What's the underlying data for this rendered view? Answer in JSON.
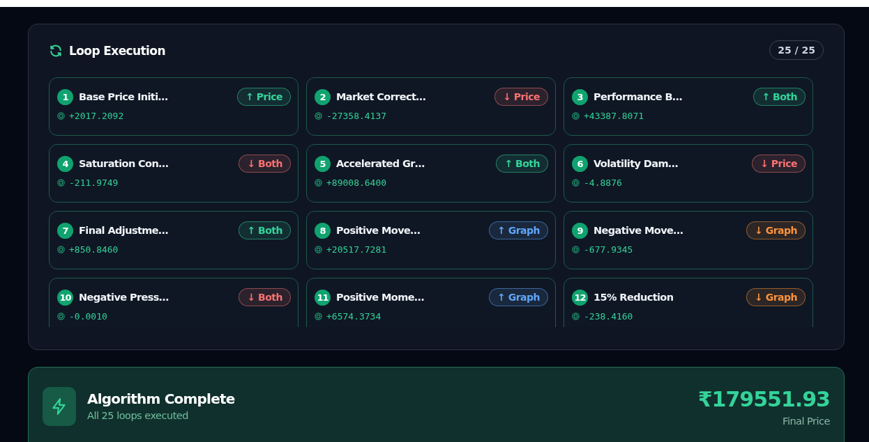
{
  "loop_panel": {
    "title": "Loop Execution",
    "counter": "25 / 25",
    "loops": [
      {
        "number": "1",
        "name": "Base Price Initi…",
        "badge": {
          "text": "↑ Price",
          "color": "#34d399"
        },
        "value": "+2017.2092"
      },
      {
        "number": "2",
        "name": "Market Correct…",
        "badge": {
          "text": "↓ Price",
          "color": "#f87171"
        },
        "value": "-27358.4137"
      },
      {
        "number": "3",
        "name": "Performance B…",
        "badge": {
          "text": "↑ Both",
          "color": "#34d399"
        },
        "value": "+43387.8071"
      },
      {
        "number": "4",
        "name": "Saturation Con…",
        "badge": {
          "text": "↓ Both",
          "color": "#f87171"
        },
        "value": "-211.9749"
      },
      {
        "number": "5",
        "name": "Accelerated Gr…",
        "badge": {
          "text": "↑ Both",
          "color": "#34d399"
        },
        "value": "+89008.6400"
      },
      {
        "number": "6",
        "name": "Volatility Dam…",
        "badge": {
          "text": "↓ Price",
          "color": "#f87171"
        },
        "value": "-4.8876"
      },
      {
        "number": "7",
        "name": "Final Adjustme…",
        "badge": {
          "text": "↑ Both",
          "color": "#34d399"
        },
        "value": "+850.8460"
      },
      {
        "number": "8",
        "name": "Positive Move…",
        "badge": {
          "text": "↑ Graph",
          "color": "#60a5fa"
        },
        "value": "+20517.7281"
      },
      {
        "number": "9",
        "name": "Negative Move…",
        "badge": {
          "text": "↓ Graph",
          "color": "#fb923c"
        },
        "value": "-677.9345"
      },
      {
        "number": "10",
        "name": "Negative Press…",
        "badge": {
          "text": "↓ Both",
          "color": "#f87171"
        },
        "value": "-0.0010"
      },
      {
        "number": "11",
        "name": "Positive Mome…",
        "badge": {
          "text": "↑ Graph",
          "color": "#60a5fa"
        },
        "value": "+6574.3734"
      },
      {
        "number": "12",
        "name": "15% Reduction",
        "badge": {
          "text": "↓ Graph",
          "color": "#fb923c"
        },
        "value": "-238.4160"
      }
    ]
  },
  "result": {
    "title": "Algorithm Complete",
    "subtitle": "All 25 loops executed",
    "price": "₹179551.93",
    "price_label": "Final Price"
  }
}
